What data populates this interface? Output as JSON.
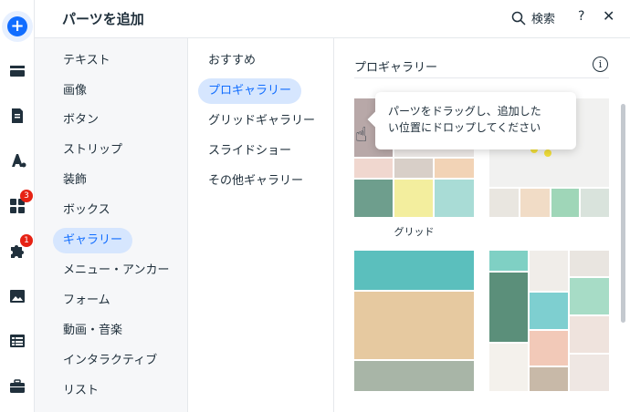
{
  "header": {
    "title": "パーツを追加",
    "search_label": "検索",
    "help_label": "?",
    "close_label": "✕"
  },
  "rail": {
    "items": [
      {
        "name": "add-icon",
        "badge": ""
      },
      {
        "name": "sections-icon",
        "badge": ""
      },
      {
        "name": "pages-icon",
        "badge": ""
      },
      {
        "name": "design-icon",
        "badge": ""
      },
      {
        "name": "apps-icon",
        "badge": "3"
      },
      {
        "name": "business-apps-icon",
        "badge": "1"
      },
      {
        "name": "media-icon",
        "badge": ""
      },
      {
        "name": "cms-icon",
        "badge": ""
      },
      {
        "name": "portfolio-icon",
        "badge": ""
      }
    ]
  },
  "categories": [
    "テキスト",
    "画像",
    "ボタン",
    "ストリップ",
    "装飾",
    "ボックス",
    "ギャラリー",
    "メニュー・アンカー",
    "フォーム",
    "動画・音楽",
    "インタラクティブ",
    "リスト"
  ],
  "active_category": "ギャラリー",
  "subcategories": [
    "おすすめ",
    "プロギャラリー",
    "グリッドギャラリー",
    "スライドショー",
    "その他ギャラリー"
  ],
  "active_subcategory": "プロギャラリー",
  "content": {
    "section_title": "プロギャラリー",
    "info_icon": "i",
    "grid_caption": "グリッド"
  },
  "tooltip": {
    "text_line1": "パーツをドラッグし、追加した",
    "text_line2": "い位置にドロップしてください"
  },
  "colors": {
    "accent": "#116dff",
    "accent_light": "#d6e6fe",
    "badge": "#e62214"
  }
}
